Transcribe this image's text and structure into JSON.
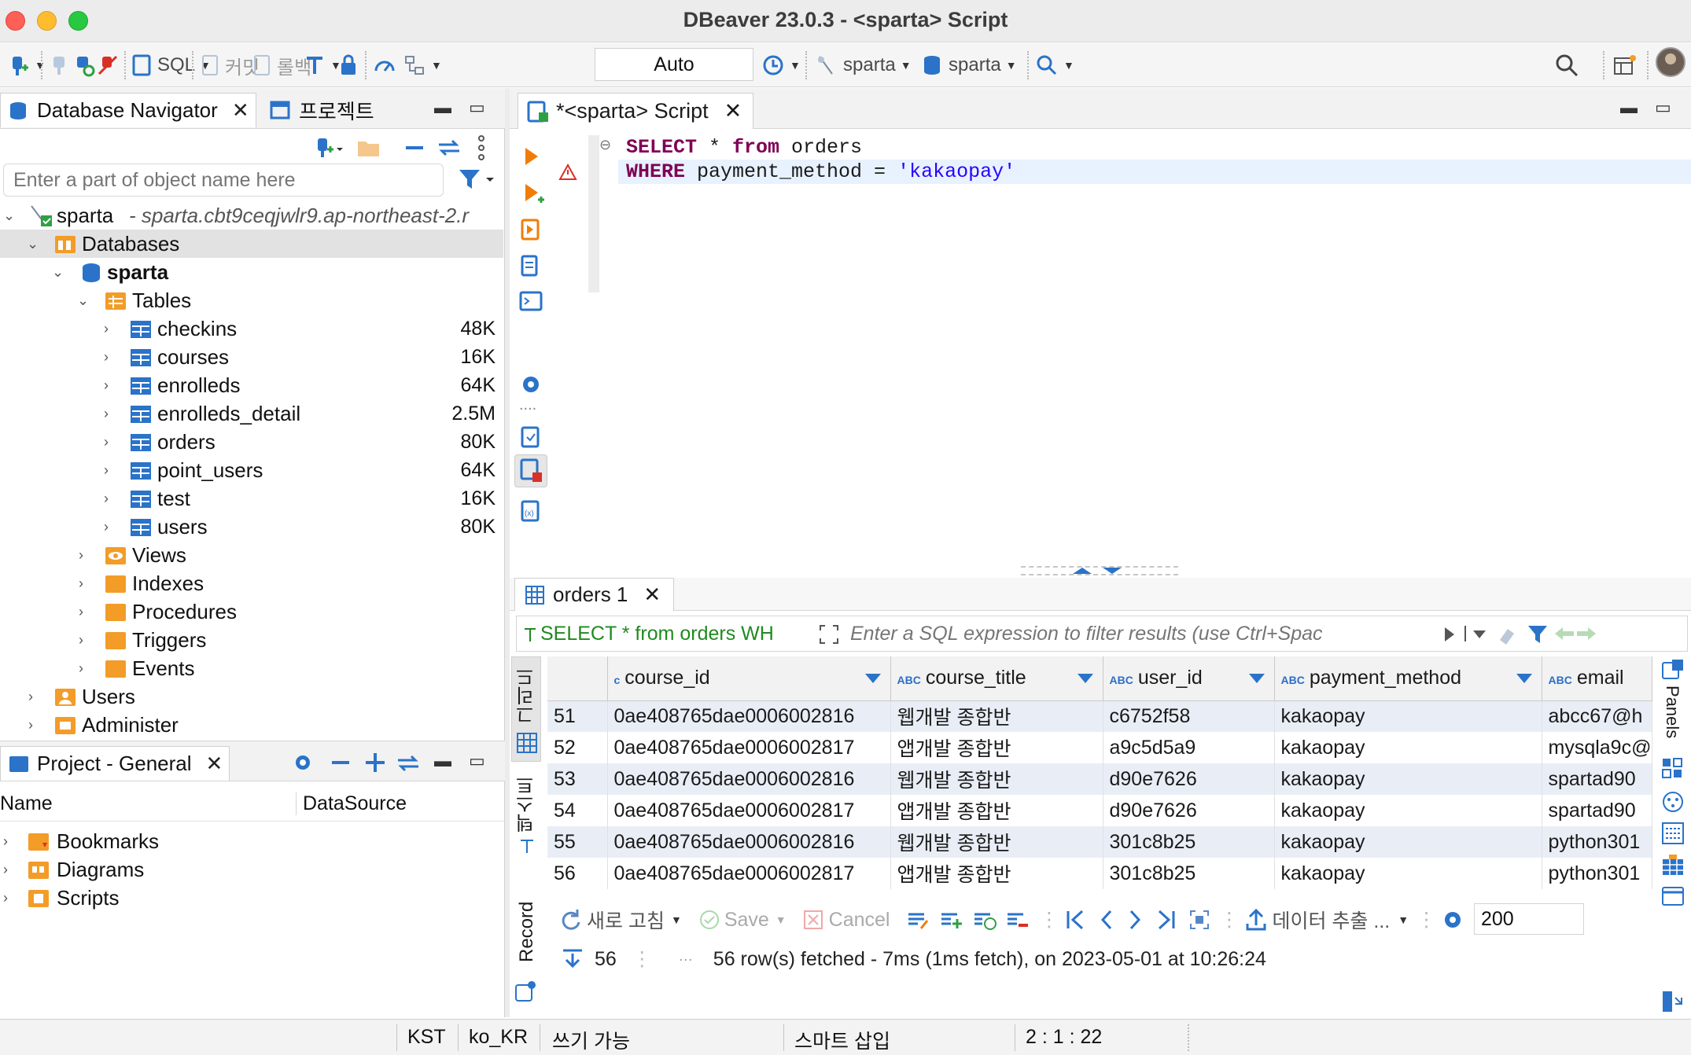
{
  "window": {
    "title": "DBeaver 23.0.3 - <sparta> Script"
  },
  "toolbar": {
    "sql_label": "SQL",
    "commit_label": "커밋",
    "rollback_label": "롤백",
    "transaction_mode": "Auto",
    "datasource_label": "sparta",
    "schema_label": "sparta"
  },
  "navigator": {
    "tab_label": "Database Navigator",
    "project_tab_label": "프로젝트",
    "filter_placeholder": "Enter a part of object name here",
    "connection": {
      "name": "sparta",
      "host": "- sparta.cbt9ceqjwlr9.ap-northeast-2.r"
    },
    "databases_label": "Databases",
    "schema_name": "sparta",
    "tables_label": "Tables",
    "tables": [
      {
        "name": "checkins",
        "size": "48K"
      },
      {
        "name": "courses",
        "size": "16K"
      },
      {
        "name": "enrolleds",
        "size": "64K"
      },
      {
        "name": "enrolleds_detail",
        "size": "2.5M"
      },
      {
        "name": "orders",
        "size": "80K"
      },
      {
        "name": "point_users",
        "size": "64K"
      },
      {
        "name": "test",
        "size": "16K"
      },
      {
        "name": "users",
        "size": "80K"
      }
    ],
    "folders": [
      "Views",
      "Indexes",
      "Procedures",
      "Triggers",
      "Events"
    ],
    "users_label": "Users",
    "administer_label": "Administer"
  },
  "project": {
    "tab_label": "Project - General",
    "col_name": "Name",
    "col_datasource": "DataSource",
    "items": [
      "Bookmarks",
      "Diagrams",
      "Scripts"
    ]
  },
  "editor": {
    "tab_label": "*<sparta> Script",
    "line1": {
      "kw1": "SELECT",
      "mid": " * ",
      "kw2": "from",
      "rest": " orders"
    },
    "line2": {
      "kw1": "WHERE",
      "rest": " payment_method = ",
      "str": "'kakaopay'"
    }
  },
  "results": {
    "tab_label": "orders 1",
    "filter_query": "SELECT * from orders WH",
    "filter_placeholder": "Enter a SQL expression to filter results (use Ctrl+Space)",
    "vtab_grid": "그리드",
    "vtab_text": "텍스트",
    "vtab_record": "Record",
    "panels_label": "Panels",
    "columns": [
      "course_id",
      "course_title",
      "user_id",
      "payment_method",
      "email"
    ],
    "rows": [
      {
        "n": "51",
        "course_id": "0ae408765dae0006002816",
        "course_title": "웹개발 종합반",
        "user_id": "c6752f58",
        "payment_method": "kakaopay",
        "email": "abcc67@h"
      },
      {
        "n": "52",
        "course_id": "0ae408765dae0006002817",
        "course_title": "앱개발 종합반",
        "user_id": "a9c5d5a9",
        "payment_method": "kakaopay",
        "email": "mysqla9c@"
      },
      {
        "n": "53",
        "course_id": "0ae408765dae0006002816",
        "course_title": "웹개발 종합반",
        "user_id": "d90e7626",
        "payment_method": "kakaopay",
        "email": "spartad90"
      },
      {
        "n": "54",
        "course_id": "0ae408765dae0006002817",
        "course_title": "앱개발 종합반",
        "user_id": "d90e7626",
        "payment_method": "kakaopay",
        "email": "spartad90"
      },
      {
        "n": "55",
        "course_id": "0ae408765dae0006002816",
        "course_title": "웹개발 종합반",
        "user_id": "301c8b25",
        "payment_method": "kakaopay",
        "email": "python301"
      },
      {
        "n": "56",
        "course_id": "0ae408765dae0006002817",
        "course_title": "앱개발 종합반",
        "user_id": "301c8b25",
        "payment_method": "kakaopay",
        "email": "python301"
      }
    ],
    "refresh_label": "새로 고침",
    "save_label": "Save",
    "cancel_label": "Cancel",
    "export_label": "데이터 추출 ...",
    "fetch_size": "200",
    "row_count": "56",
    "status_text": "56 row(s) fetched - 7ms (1ms fetch), on 2023-05-01 at 10:26:24"
  },
  "statusbar": {
    "timezone": "KST",
    "locale": "ko_KR",
    "mode": "쓰기 가능",
    "insert_mode": "스마트 삽입",
    "position": "2 : 1 : 22"
  },
  "colors": {
    "accent": "#2a73c9",
    "keyword": "#7f0055",
    "string": "#2a00ff",
    "folder": "#f39c28",
    "row_alt": "#e9eef6"
  }
}
